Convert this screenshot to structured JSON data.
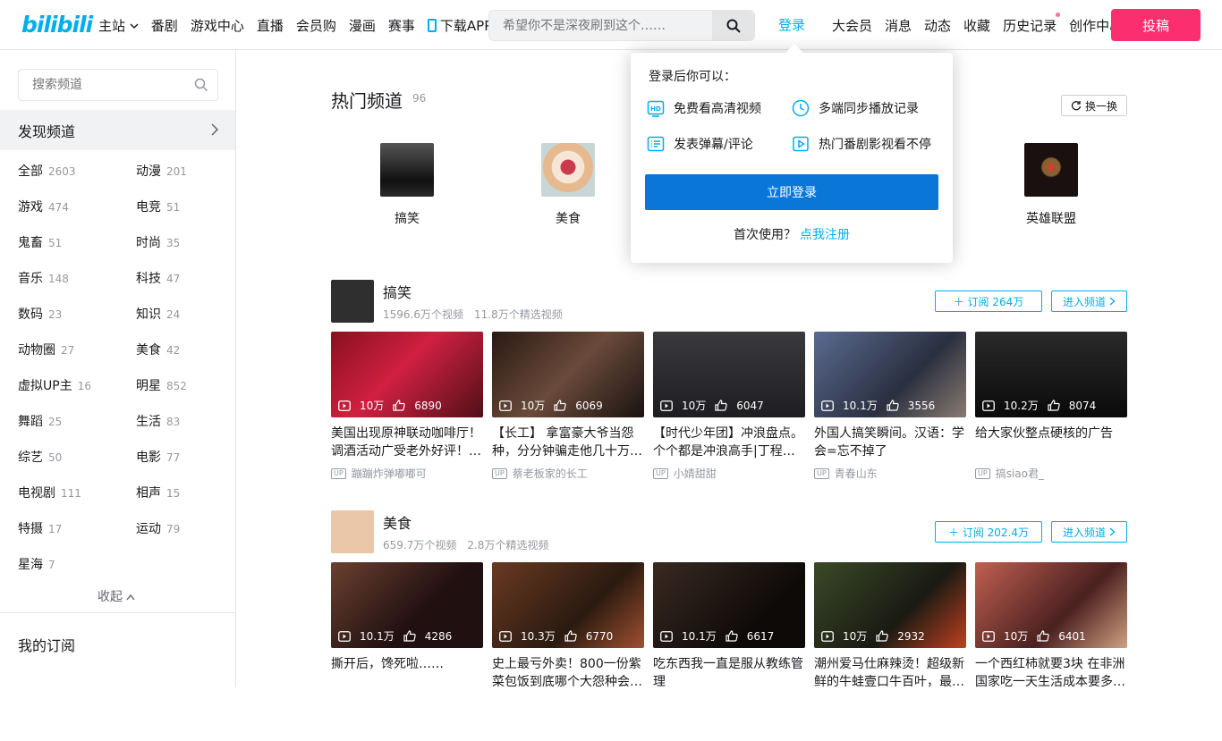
{
  "header": {
    "logo_text": "bilibili",
    "nav": [
      "主站",
      "番剧",
      "游戏中心",
      "直播",
      "会员购",
      "漫画",
      "赛事",
      "下载APP"
    ],
    "search_placeholder": "希望你不是深夜刷到这个……",
    "login": "登录",
    "right_nav": [
      "大会员",
      "消息",
      "动态",
      "收藏",
      "历史记录",
      "创作中心"
    ],
    "upload": "投稿"
  },
  "sidebar": {
    "search_placeholder": "搜索频道",
    "discover": "发现频道",
    "categories": [
      {
        "name": "全部",
        "count": "2603"
      },
      {
        "name": "动漫",
        "count": "201"
      },
      {
        "name": "游戏",
        "count": "474"
      },
      {
        "name": "电竞",
        "count": "51"
      },
      {
        "name": "鬼畜",
        "count": "51"
      },
      {
        "name": "时尚",
        "count": "35"
      },
      {
        "name": "音乐",
        "count": "148"
      },
      {
        "name": "科技",
        "count": "47"
      },
      {
        "name": "数码",
        "count": "23"
      },
      {
        "name": "知识",
        "count": "24"
      },
      {
        "name": "动物圈",
        "count": "27"
      },
      {
        "name": "美食",
        "count": "42"
      },
      {
        "name": "虚拟UP主",
        "count": "16"
      },
      {
        "name": "明星",
        "count": "852"
      },
      {
        "name": "舞蹈",
        "count": "25"
      },
      {
        "name": "生活",
        "count": "83"
      },
      {
        "name": "综艺",
        "count": "50"
      },
      {
        "name": "电影",
        "count": "77"
      },
      {
        "name": "电视剧",
        "count": "111"
      },
      {
        "name": "相声",
        "count": "15"
      },
      {
        "name": "特摄",
        "count": "17"
      },
      {
        "name": "运动",
        "count": "79"
      },
      {
        "name": "星海",
        "count": "7"
      }
    ],
    "collapse": "收起",
    "my_subscriptions": "我的订阅"
  },
  "hot": {
    "title": "热门频道",
    "count": "96",
    "swap": "换一换",
    "items": [
      {
        "name": "搞笑",
        "color": "#2a2a2a"
      },
      {
        "name": "美食",
        "color": "#e8b7a0"
      },
      {
        "name": "英雄联盟",
        "color": "#1a1010"
      }
    ]
  },
  "channels": [
    {
      "name": "搞笑",
      "videos_count": "1596.6万个视频",
      "featured": "11.8万个精选视频",
      "subscribe": "订阅 264万",
      "enter": "进入频道",
      "avatar_color": "#2f2f2f",
      "videos": [
        {
          "views": "10万",
          "likes": "6890",
          "title": "美国出现原神联动咖啡厅！调酒活动广受老外好评！…",
          "up": "蹦蹦炸弹嘟嘟可",
          "color": "#8a1020"
        },
        {
          "views": "10万",
          "likes": "6069",
          "title": "【长工】 拿富豪大爷当怨种，分分钟骗走他几十万…",
          "up": "蔡老板家的长工",
          "color": "#3a2a20"
        },
        {
          "views": "10万",
          "likes": "6047",
          "title": "【时代少年团】冲浪盘点。个个都是冲浪高手|丁程…",
          "up": "小婧甜甜",
          "color": "#2c2c30"
        },
        {
          "views": "10.1万",
          "likes": "3556",
          "title": "外国人搞笑瞬间。汉语：学会=忘不掉了",
          "up": "青春山东",
          "color": "#3a4a70"
        },
        {
          "views": "10.2万",
          "likes": "8074",
          "title": "给大家伙整点硬核的广告",
          "up": "搞siao君_",
          "color": "#1a1a1a"
        }
      ]
    },
    {
      "name": "美食",
      "videos_count": "659.7万个视频",
      "featured": "2.8万个精选视频",
      "subscribe": "订阅 202.4万",
      "enter": "进入频道",
      "avatar_color": "#e9c7a8",
      "videos": [
        {
          "views": "10.1万",
          "likes": "4286",
          "title": "撕开后，馋死啦……",
          "up": "",
          "color": "#3b2016"
        },
        {
          "views": "10.3万",
          "likes": "6770",
          "title": "史上最亏外卖！800一份紫菜包饭到底哪个大怨种会…",
          "up": "",
          "color": "#4a2a1a"
        },
        {
          "views": "10.1万",
          "likes": "6617",
          "title": "吃东西我一直是服从教练管理",
          "up": "",
          "color": "#1e1a18"
        },
        {
          "views": "10万",
          "likes": "2932",
          "title": "潮州爱马仕麻辣烫！超级新鲜的牛蛙壹口牛百叶，最…",
          "up": "",
          "color": "#2a3320"
        },
        {
          "views": "10万",
          "likes": "6401",
          "title": "一个西红柿就要3块 在非洲国家吃一天生活成本要多…",
          "up": "",
          "color": "#6a3a30"
        }
      ]
    }
  ],
  "login_popup": {
    "heading": "登录后你可以：",
    "features": [
      "免费看高清视频",
      "多端同步播放记录",
      "发表弹幕/评论",
      "热门番剧影视看不停"
    ],
    "button": "立即登录",
    "first_use": "首次使用？",
    "register": "点我注册"
  },
  "colors": {
    "brand_blue": "#00aeec",
    "brand_pink": "#fb7299",
    "upload_bg": "#fb2f70",
    "login_button": "#0a77d8"
  }
}
